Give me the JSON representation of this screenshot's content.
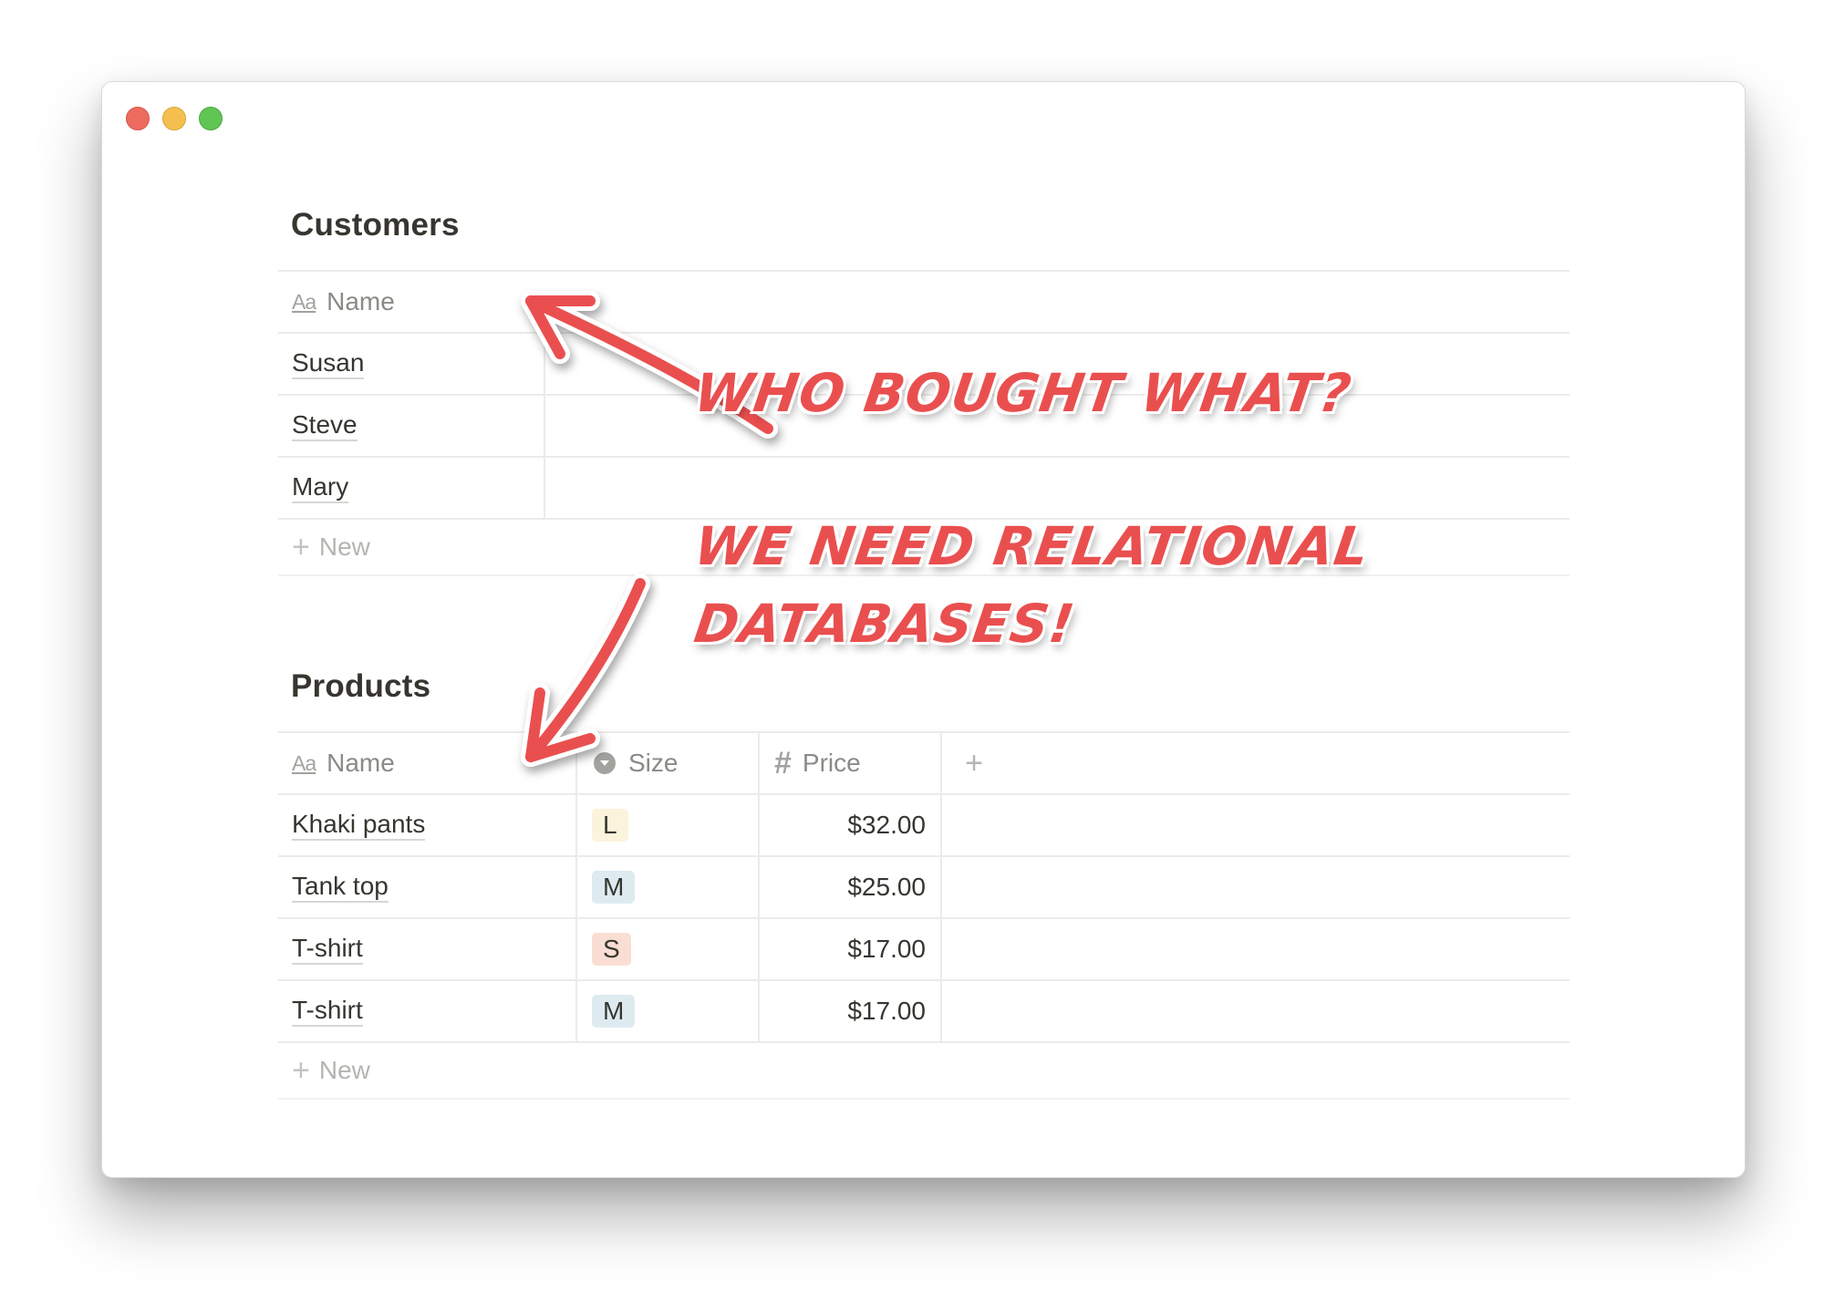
{
  "window": {
    "controls": [
      "close",
      "minimize",
      "maximize"
    ],
    "colors": {
      "close": "#ed6a5e",
      "minimize": "#f5bf4f",
      "maximize": "#61c554"
    }
  },
  "customers": {
    "title": "Customers",
    "columns": {
      "name_icon": "Aa",
      "name": "Name"
    },
    "rows": [
      {
        "name": "Susan"
      },
      {
        "name": "Steve"
      },
      {
        "name": "Mary"
      }
    ],
    "new_label": "New"
  },
  "products": {
    "title": "Products",
    "columns": {
      "name_icon": "Aa",
      "name": "Name",
      "size": "Size",
      "price": "Price"
    },
    "rows": [
      {
        "name": "Khaki pants",
        "size": "L",
        "price": "$32.00"
      },
      {
        "name": "Tank top",
        "size": "M",
        "price": "$25.00"
      },
      {
        "name": "T-shirt",
        "size": "S",
        "price": "$17.00"
      },
      {
        "name": "T-shirt",
        "size": "M",
        "price": "$17.00"
      }
    ],
    "new_label": "New"
  },
  "tag_colors": {
    "L": "#fbf3db",
    "M": "#ddebf1",
    "S": "#faded4"
  },
  "annotations": {
    "line1": "WHO BOUGHT WHAT?",
    "line2": "WE NEED RELATIONAL",
    "line3": "DATABASES!",
    "color": "#ea4f4f"
  },
  "icons": {
    "name_column": "aa-text-icon",
    "size_column": "select-circle-icon",
    "price_column": "hash-icon",
    "add_column": "plus-icon",
    "new_row": "plus-icon"
  }
}
